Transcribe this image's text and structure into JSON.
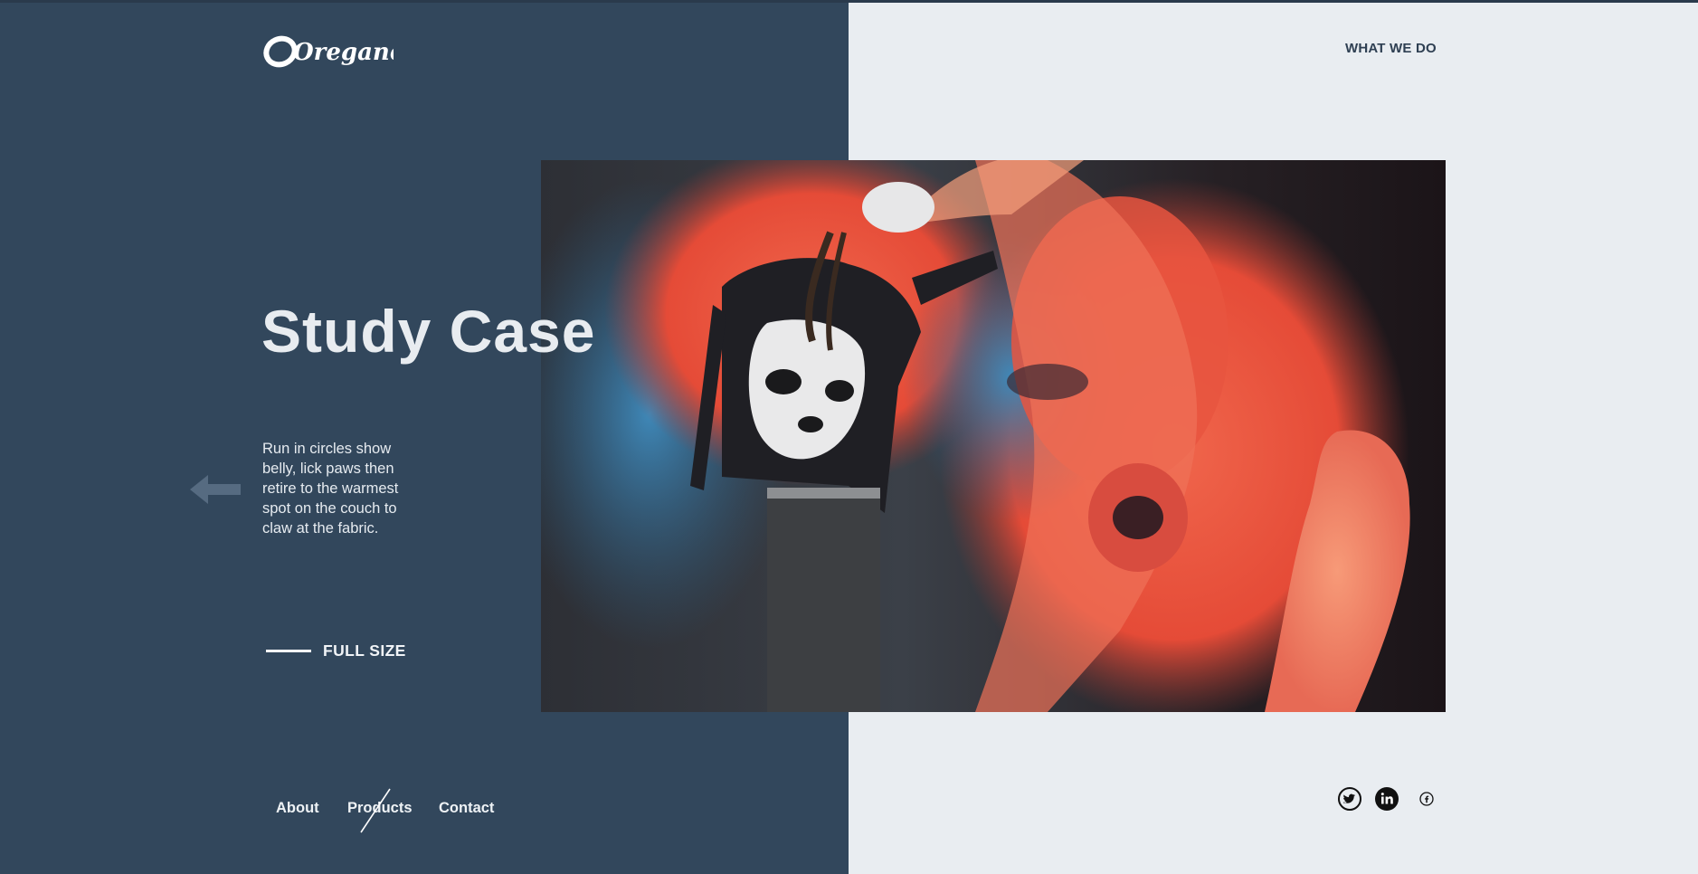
{
  "brand": {
    "logo_text": "Oregano"
  },
  "header": {
    "nav_label": "WHAT WE DO"
  },
  "hero": {
    "title": "Study Case",
    "description": "Run in circles show belly, lick paws then retire to the warmest spot on the couch to claw at the fabric.",
    "full_size_label": "FULL SIZE",
    "image_alt": "Graffiti artist in panda sweatshirt spray-painting a mural"
  },
  "footer": {
    "nav": [
      {
        "label": "About"
      },
      {
        "label": "Products"
      },
      {
        "label": "Contact"
      }
    ],
    "social": [
      {
        "icon": "twitter-icon"
      },
      {
        "icon": "linkedin-icon"
      },
      {
        "icon": "facebook-icon"
      }
    ]
  },
  "colors": {
    "left_panel": "#32475c",
    "right_panel": "#e9edf1",
    "accent_text": "#2e3f52"
  }
}
